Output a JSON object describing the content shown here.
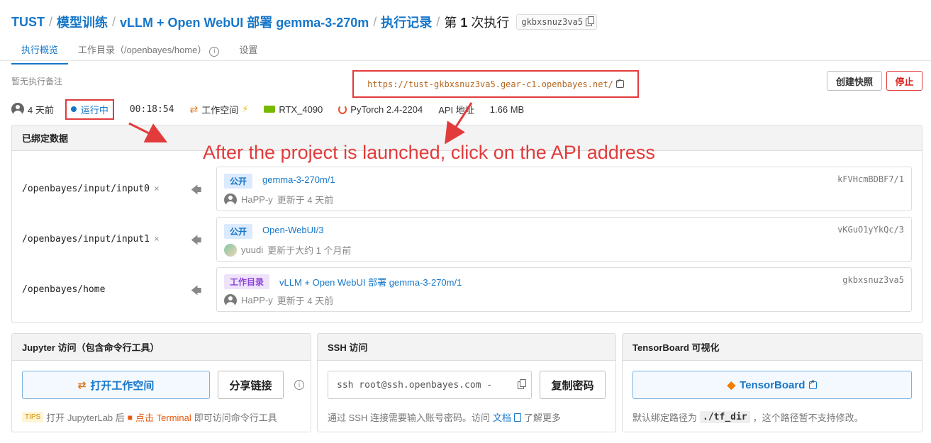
{
  "breadcrumb": {
    "items": [
      "TUST",
      "模型训练",
      "vLLM + Open WebUI 部署 gemma-3-270m",
      "执行记录"
    ],
    "current_prefix": "第",
    "current_number": "1",
    "current_suffix": "次执行",
    "run_id": "gkbxsnuz3va5"
  },
  "tabs": [
    "执行概览",
    "工作目录（/openbayes/home）",
    "设置"
  ],
  "note": "暂无执行备注",
  "api_url": "https://tust-gkbxsnuz3va5.gear-c1.openbayes.net/",
  "buttons": {
    "snapshot": "创建快照",
    "stop": "停止"
  },
  "status": {
    "created": "4 天前",
    "state": "运行中",
    "duration": "00:18:54",
    "workspace": "工作空间",
    "gpu": "RTX_4090",
    "framework": "PyTorch 2.4-2204",
    "api": "API 地址",
    "size": "1.66 MB"
  },
  "annotation": "After the project is launched, click on the API address",
  "bound_data": {
    "title": "已绑定数据",
    "rows": [
      {
        "path": "/openbayes/input/input0",
        "tag": "公开",
        "name": "gemma-3-270m/1",
        "hash": "kFVHcmBDBF7/1",
        "user": "HaPP-y",
        "updated": "更新于 4 天前"
      },
      {
        "path": "/openbayes/input/input1",
        "tag": "公开",
        "name": "Open-WebUI/3",
        "hash": "vKGuO1yYkQc/3",
        "user": "yuudi",
        "updated": "更新于大约 1 个月前"
      },
      {
        "path": "/openbayes/home",
        "tag": "工作目录",
        "name": "vLLM + Open WebUI 部署 gemma-3-270m/1",
        "hash": "gkbxsnuz3va5",
        "user": "HaPP-y",
        "updated": "更新于 4 天前"
      }
    ]
  },
  "jupyter": {
    "title": "Jupyter 访问（包含命令行工具）",
    "open_btn": "打开工作空间",
    "share_btn": "分享链接",
    "tips": "TIPS",
    "foot_1": "打开 JupyterLab 后",
    "foot_2": "点击 Terminal",
    "foot_3": "即可访问命令行工具"
  },
  "ssh": {
    "title": "SSH 访问",
    "command": "ssh root@ssh.openbayes.com -",
    "copy_btn": "复制密码",
    "foot_1": "通过 SSH 连接需要输入账号密码。访问",
    "foot_link": "文档",
    "foot_2": "了解更多"
  },
  "tensorboard": {
    "title": "TensorBoard 可视化",
    "btn": "TensorBoard",
    "foot_1": "默认绑定路径为",
    "foot_code": "./tf_dir",
    "foot_2": "，这个路径暂不支持修改。"
  },
  "colors": {
    "accent": "#1677c9",
    "danger": "#e23b3b",
    "orange": "#e8590c"
  }
}
